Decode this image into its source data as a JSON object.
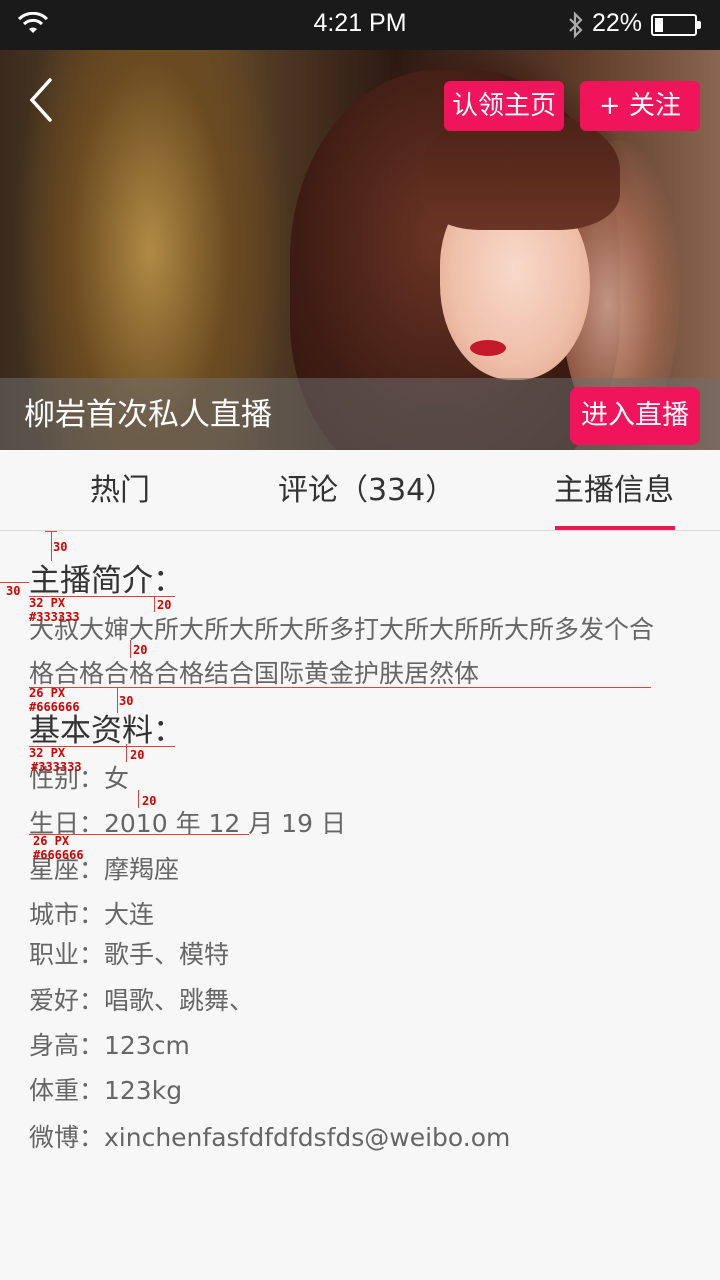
{
  "status_bar": {
    "time": "4:21 PM",
    "battery_percent": "22%",
    "battery_level": 0.22
  },
  "hero": {
    "claim_label": "认领主页",
    "follow_label": "+ 关注",
    "title": "柳岩首次私人直播",
    "enter_live_label": "进入直播"
  },
  "tabs": [
    {
      "label": "热门"
    },
    {
      "label": "评论（334）"
    },
    {
      "label": "主播信息",
      "active": true
    }
  ],
  "intro": {
    "heading": "主播简介：",
    "text": "大叔大婶大所大所大所大所多打大所大所所大所多发个合格合格合格合格结合国际黄金护肤居然体"
  },
  "profile": {
    "heading": "基本资料：",
    "fields": [
      "性别：女",
      "生日：2010 年 12 月 19 日",
      "星座：摩羯座",
      "城市：大连",
      "职业：歌手、模特",
      "爱好：唱歌、跳舞、",
      "身高：123cm",
      "体重：123kg",
      "微博：xinchenfasfdfdfdsfds@weibo.om"
    ]
  },
  "annotations": {
    "a30_top": "30",
    "a30_left": "30",
    "a32px_1": "32 PX",
    "a333_1": "#333333",
    "a20_1": "20",
    "a20_2": "20",
    "a26px_1": "26 PX",
    "a666_1": "#666666",
    "a30_mid": "30",
    "a32px_2": "32 PX",
    "a333_2": "#333333",
    "a20_3": "20",
    "a20_4": "20",
    "a26px_2": "26 PX",
    "a666_2": "#666666"
  },
  "colors": {
    "accent": "#f0145a",
    "heading": "#333333",
    "body": "#666666",
    "annotation": "#d60000"
  }
}
